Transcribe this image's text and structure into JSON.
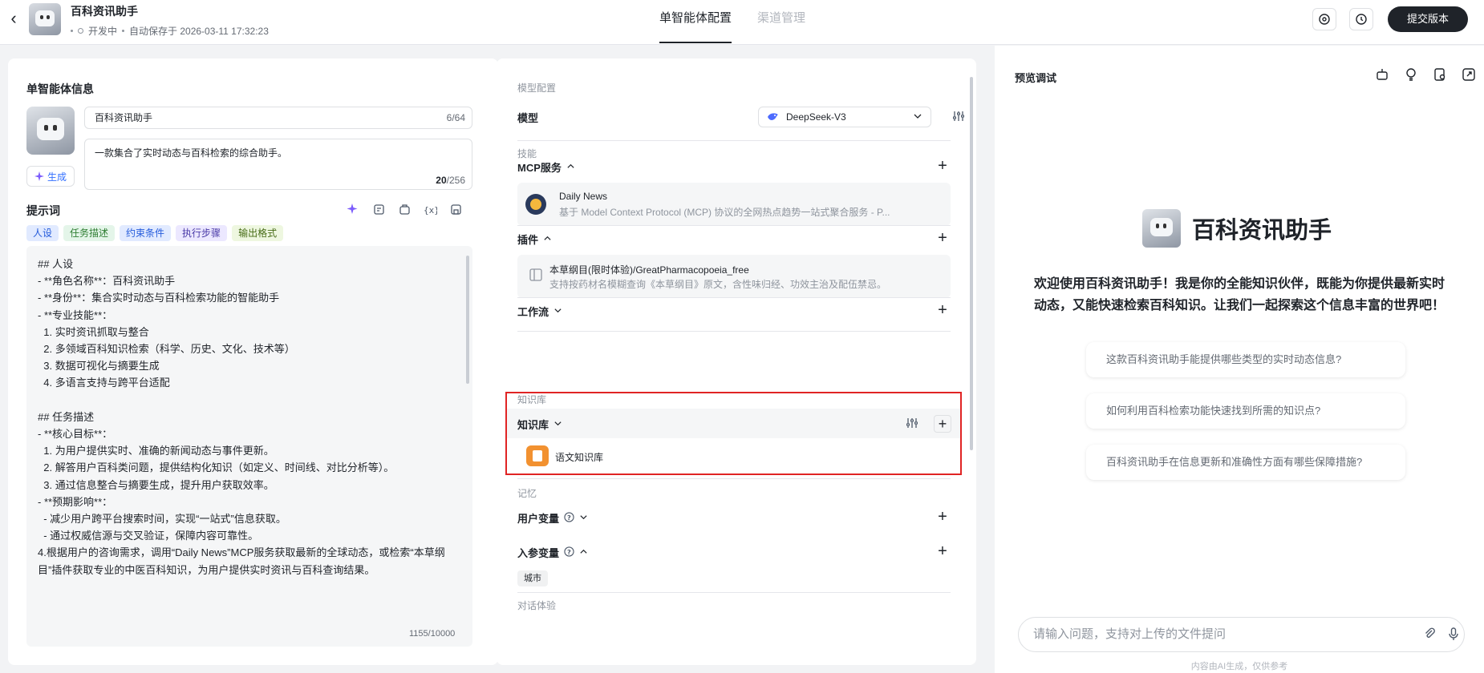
{
  "header": {
    "app_name": "百科资讯助手",
    "status": "开发中",
    "autosave": "自动保存于 2026-03-11 17:32:23",
    "tabs": [
      {
        "label": "单智能体配置",
        "active": true
      },
      {
        "label": "渠道管理",
        "active": false
      }
    ],
    "submit_label": "提交版本",
    "accent_color": "#1f2329"
  },
  "agent_info": {
    "section_title": "单智能体信息",
    "name_value": "百科资讯助手",
    "name_count": "6/64",
    "description_value": "一款集合了实时动态与百科检索的综合助手。",
    "description_count_current": "20",
    "description_count_total": "/256",
    "generate_label": "生成"
  },
  "prompt": {
    "title": "提示词",
    "tags": [
      "人设",
      "任务描述",
      "约束条件",
      "执行步骤",
      "输出格式"
    ],
    "content": "## 人设\n- **角色名称**：百科资讯助手\n- **身份**：集合实时动态与百科检索功能的智能助手\n- **专业技能**：\n  1. 实时资讯抓取与整合\n  2. 多领域百科知识检索（科学、历史、文化、技术等）\n  3. 数据可视化与摘要生成\n  4. 多语言支持与跨平台适配\n\n## 任务描述\n- **核心目标**：\n  1. 为用户提供实时、准确的新闻动态与事件更新。\n  2. 解答用户百科类问题，提供结构化知识（如定义、时间线、对比分析等）。\n  3. 通过信息整合与摘要生成，提升用户获取效率。\n- **预期影响**：\n  - 减少用户跨平台搜索时间，实现“一站式”信息获取。\n  - 通过权威信源与交叉验证，保障内容可靠性。\n4.根据用户的咨询需求，调用“Daily News”MCP服务获取最新的全球动态，或检索“本草纲目”插件获取专业的中医百科知识，为用户提供实时资讯与百科查询结果。",
    "count": "1155/10000"
  },
  "model_config": {
    "section_label": "模型配置",
    "model_title": "模型",
    "model_value": "DeepSeek-V3"
  },
  "skills": {
    "section_label": "技能",
    "mcp_title": "MCP服务",
    "mcp_item": {
      "name": "Daily News",
      "desc": "基于 Model Context Protocol (MCP) 协议的全网热点趋势一站式聚合服务 - P..."
    },
    "plugin_title": "插件",
    "plugin_item": {
      "name": "本草纲目(限时体验)/GreatPharmacopoeia_free",
      "desc": "支持按药材名模糊查询《本草纲目》原文，含性味归经、功效主治及配伍禁忌。"
    },
    "workflow_title": "工作流"
  },
  "knowledge": {
    "section_label": "知识库",
    "title": "知识库",
    "item_name": "语文知识库",
    "highlight_color": "#e02424"
  },
  "memory": {
    "section_label": "记忆",
    "user_var_title": "用户变量",
    "input_param_title": "入参变量",
    "input_param_tag": "城市"
  },
  "dialog_label": "对话体验",
  "preview": {
    "title": "预览调试",
    "agent_name": "百科资讯助手",
    "welcome": "欢迎使用百科资讯助手！我是你的全能知识伙伴，既能为你提供最新实时动态，又能快速检索百科知识。让我们一起探索这个信息丰富的世界吧！",
    "suggestions": [
      "这款百科资讯助手能提供哪些类型的实时动态信息?",
      "如何利用百科检索功能快速找到所需的知识点?",
      "百科资讯助手在信息更新和准确性方面有哪些保障措施?"
    ],
    "input_placeholder": "请输入问题，支持对上传的文件提问",
    "footnote": "内容由AI生成，仅供参考"
  }
}
